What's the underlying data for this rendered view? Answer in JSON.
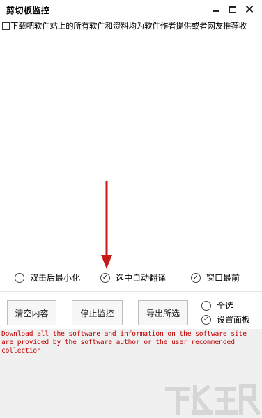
{
  "window": {
    "title": "剪切板监控"
  },
  "list": {
    "items": [
      {
        "text": "下载吧软件站上的所有软件和资料均为软件作者提供或者网友推荐收",
        "checked": false
      }
    ]
  },
  "options": {
    "minimize_on_double_click": {
      "label": "双击后最小化",
      "checked": false
    },
    "auto_translate": {
      "label": "选中自动翻译",
      "checked": true
    },
    "always_on_top": {
      "label": "窗口最前",
      "checked": true
    }
  },
  "buttons": {
    "clear": "清空内容",
    "stop_monitor": "停止监控",
    "export_selected": "导出所选"
  },
  "side_options": {
    "select_all": {
      "label": "全选",
      "checked": false
    },
    "settings_panel": {
      "label": "设置面板",
      "checked": true
    }
  },
  "log": {
    "text": "Download all the software and information on the software site are provided by the software author or the user recommended collection"
  },
  "colors": {
    "log_text": "#c00000",
    "arrow": "#c91a1a",
    "log_background": "#f0f0f0"
  },
  "icons": {
    "minimize": "minimize-icon",
    "maximize": "maximize-icon",
    "close": "close-icon",
    "annotation_arrow": "arrow-down-icon",
    "watermark": "xiazaiba-logo"
  }
}
